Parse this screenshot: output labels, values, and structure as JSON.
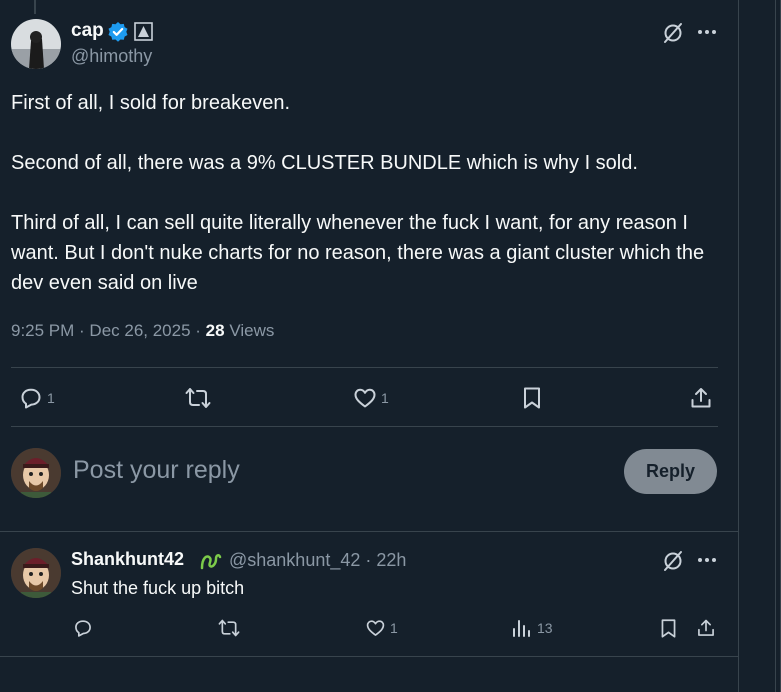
{
  "tweet": {
    "author_name": "cap",
    "author_handle": "@himothy",
    "paragraphs": [
      "First of all, I sold for breakeven.",
      "Second of all, there was a 9% CLUSTER BUNDLE which is why I sold.",
      "Third of all, I can sell quite literally whenever the fuck I want, for any reason I want. But I don't nuke charts for no reason, there was a giant cluster which the dev even said on live"
    ],
    "time": "9:25 PM",
    "date": "Dec 26, 2025",
    "views_count": "28",
    "views_label": "Views",
    "reply_count": "1",
    "like_count": "1"
  },
  "composer": {
    "placeholder": "Post your reply",
    "reply_button": "Reply"
  },
  "reply": {
    "author_name": "Shankhunt42",
    "author_handle": "@shankhunt_42",
    "time_ago": "22h",
    "text": "Shut the fuck up bitch",
    "like_count": "1",
    "views_count": "13"
  },
  "colors": {
    "background": "#15202b",
    "text": "#f7f9f9",
    "muted": "#8b98a5",
    "verified": "#1d9bf0",
    "divider": "#38444d"
  },
  "icons": [
    "grok-icon",
    "more-icon",
    "reply-icon",
    "repost-icon",
    "like-icon",
    "bookmark-icon",
    "share-icon",
    "views-icon",
    "verified-badge-icon",
    "affiliate-badge-icon"
  ]
}
